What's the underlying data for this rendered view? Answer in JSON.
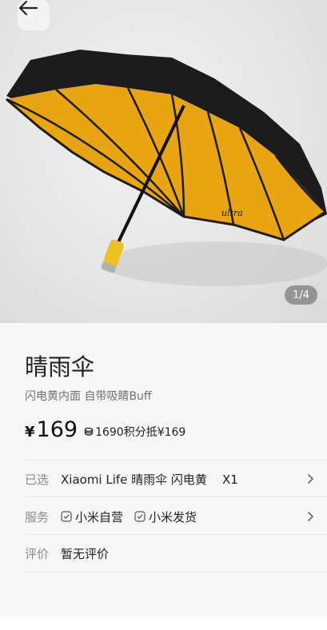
{
  "hero": {
    "image_subject": "umbrella-product-photo",
    "counter": "1/4",
    "brand_script": "ultra"
  },
  "product": {
    "title": "晴雨伞",
    "subtitle": "闪电黄内面 自带吸睛Buff",
    "currency": "¥",
    "price": "169",
    "points_text": "1690积分抵¥169"
  },
  "rows": {
    "selected": {
      "label": "已选",
      "value": "Xiaomi Life 晴雨伞 闪电黄    X1"
    },
    "service": {
      "label": "服务",
      "items": [
        "小米自营",
        "小米发货"
      ]
    },
    "review": {
      "label": "评价",
      "value": "暂无评价"
    }
  },
  "colors": {
    "umbrella_canopy_inner": "#e9a412",
    "umbrella_canopy_outer": "#1c1c1c",
    "handle": "#f0c020"
  }
}
